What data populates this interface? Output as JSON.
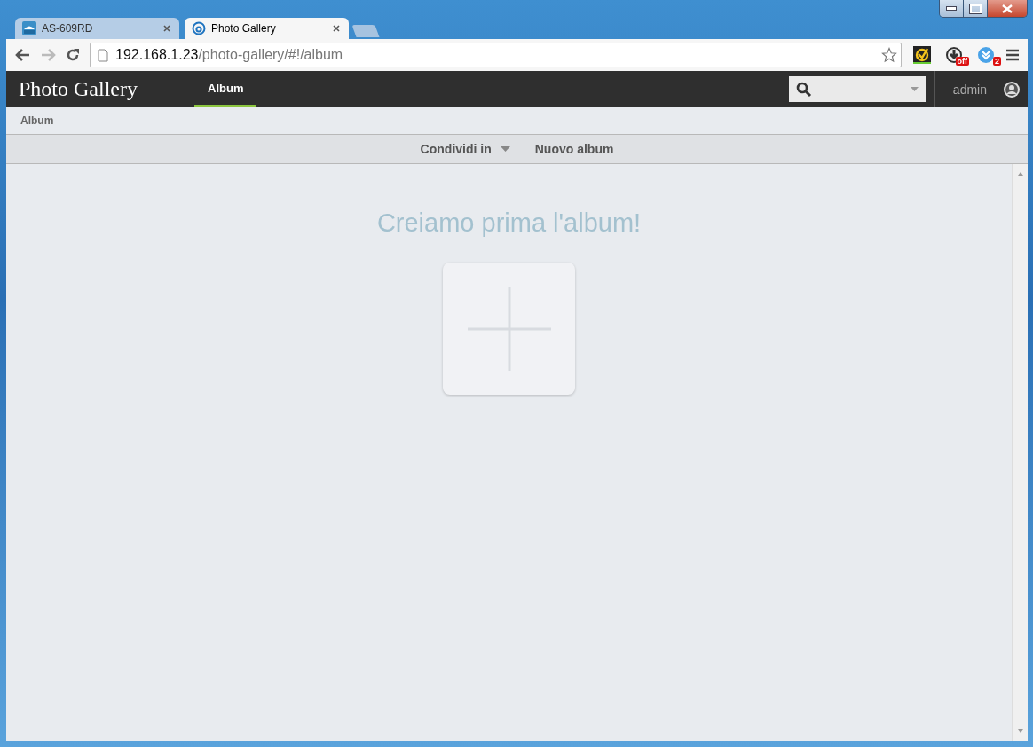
{
  "browser": {
    "tabs": [
      {
        "title": "AS-609RD",
        "kind": "logo",
        "selected": false
      },
      {
        "title": "Photo Gallery",
        "kind": "letter",
        "selected": true
      }
    ],
    "url": {
      "host": "192.168.1.23",
      "path": "/photo-gallery/#!/album"
    },
    "extensions": [
      {
        "kind": "check"
      },
      {
        "kind": "download",
        "badge": "off"
      },
      {
        "kind": "blue",
        "badge": "2"
      }
    ]
  },
  "app": {
    "title": "Photo Gallery",
    "nav": [
      {
        "label": "Album",
        "selected": true
      }
    ],
    "user": "admin"
  },
  "breadcrumb": "Album",
  "toolbar": [
    {
      "label": "Condividi in",
      "dropdown": true
    },
    {
      "label": "Nuovo album",
      "dropdown": false
    }
  ],
  "empty": {
    "message": "Creiamo prima l'album!"
  }
}
